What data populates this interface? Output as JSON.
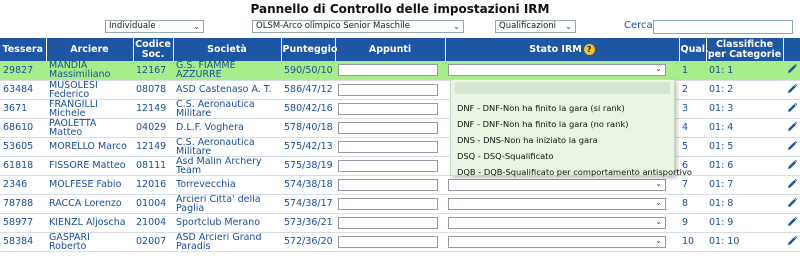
{
  "title": "Pannello di Controllo delle impostazioni IRM",
  "filters": {
    "type": "Individuale",
    "division": "OLSM-Arco olimpico Senior Maschile",
    "phase": "Qualificazioni",
    "search_label": "Cerca",
    "search_value": ""
  },
  "columns": {
    "tessera": "Tessera",
    "arciere": "Arciere",
    "codice": "Codice Soc.",
    "societa": "Società",
    "punteggio": "Punteggio",
    "appunti": "Appunti",
    "stato": "Stato IRM",
    "qual": "Qual.",
    "classifiche": "Classifiche per Categorie"
  },
  "rows": [
    {
      "tessera": "29827",
      "arciere": "MANDIA Massimiliano",
      "codice": "12167",
      "societa": "G.S. FIAMME AZZURRE",
      "punteggio": "590/50/10",
      "qual": "1",
      "classifica": "01: 1"
    },
    {
      "tessera": "63484",
      "arciere": "MUSOLESI Federico",
      "codice": "08078",
      "societa": "ASD Castenaso A. T.",
      "punteggio": "586/47/12",
      "qual": "2",
      "classifica": "01: 2"
    },
    {
      "tessera": "3671",
      "arciere": "FRANGILLI Michele",
      "codice": "12149",
      "societa": "C.S. Aeronautica Militare",
      "punteggio": "580/42/16",
      "qual": "3",
      "classifica": "01: 3"
    },
    {
      "tessera": "68610",
      "arciere": "PAOLETTA Matteo",
      "codice": "04029",
      "societa": "D.L.F. Voghera",
      "punteggio": "578/40/18",
      "qual": "4",
      "classifica": "01: 4"
    },
    {
      "tessera": "53605",
      "arciere": "MORELLO Marco",
      "codice": "12149",
      "societa": "C.S. Aeronautica Militare",
      "punteggio": "575/42/13",
      "qual": "5",
      "classifica": "01: 5"
    },
    {
      "tessera": "61818",
      "arciere": "FISSORE Matteo",
      "codice": "08111",
      "societa": "Asd Malin Archery Team",
      "punteggio": "575/38/19",
      "qual": "6",
      "classifica": "01: 6"
    },
    {
      "tessera": "2346",
      "arciere": "MOLFESE Fabio",
      "codice": "12016",
      "societa": "Torrevecchia",
      "punteggio": "574/38/18",
      "qual": "7",
      "classifica": "01: 7"
    },
    {
      "tessera": "78788",
      "arciere": "RACCA Lorenzo",
      "codice": "01004",
      "societa": "Arcieri Citta' della Paglia",
      "punteggio": "574/38/17",
      "qual": "8",
      "classifica": "01: 8"
    },
    {
      "tessera": "58977",
      "arciere": "KIENZL Aljoscha",
      "codice": "21004",
      "societa": "Sportclub Merano",
      "punteggio": "573/36/21",
      "qual": "9",
      "classifica": "01: 9"
    },
    {
      "tessera": "58384",
      "arciere": "GASPARI Roberto",
      "codice": "02007",
      "societa": "ASD Arcieri Grand Paradis",
      "punteggio": "572/36/20",
      "qual": "10",
      "classifica": "01: 10"
    }
  ],
  "irm_options": [
    "",
    "DNF - DNF-Non ha finito la gara (si rank)",
    "DNF - DNF-Non ha finito la gara (no rank)",
    "DNS - DNS-Non ha iniziato la gara",
    "DSQ - DSQ-Squalificato",
    "DQB - DQB-Squalificato per comportamento antisportivo"
  ],
  "help_symbol": "?",
  "colors": {
    "header": "#1f56a3",
    "highlight_row": "#a7ee8a",
    "dropdown_bg": "#e8f6e3",
    "text": "#1a57a8"
  }
}
